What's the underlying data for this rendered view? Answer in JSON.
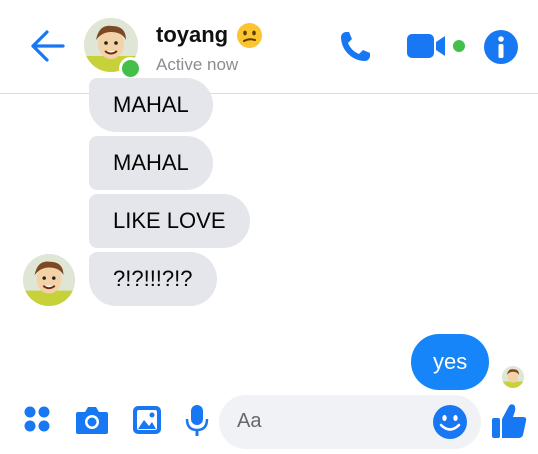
{
  "header": {
    "contact_name": "toyang",
    "status": "Active now"
  },
  "messages": {
    "received": [
      "MAHAL",
      "MAHAL",
      "LIKE LOVE",
      "?!?!!!?!?"
    ],
    "sent": [
      "yes"
    ]
  },
  "composer": {
    "placeholder": "Aa"
  },
  "colors": {
    "accent": "#0084ff",
    "online": "#44c04a",
    "received_bubble": "#e4e6eb",
    "sent_bubble": "#1685f9"
  },
  "icons": [
    "back-arrow-icon",
    "phone-icon",
    "video-camera-icon",
    "info-icon",
    "apps-grid-icon",
    "camera-icon",
    "gallery-icon",
    "microphone-icon",
    "emoji-icon",
    "thumbs-up-icon"
  ]
}
